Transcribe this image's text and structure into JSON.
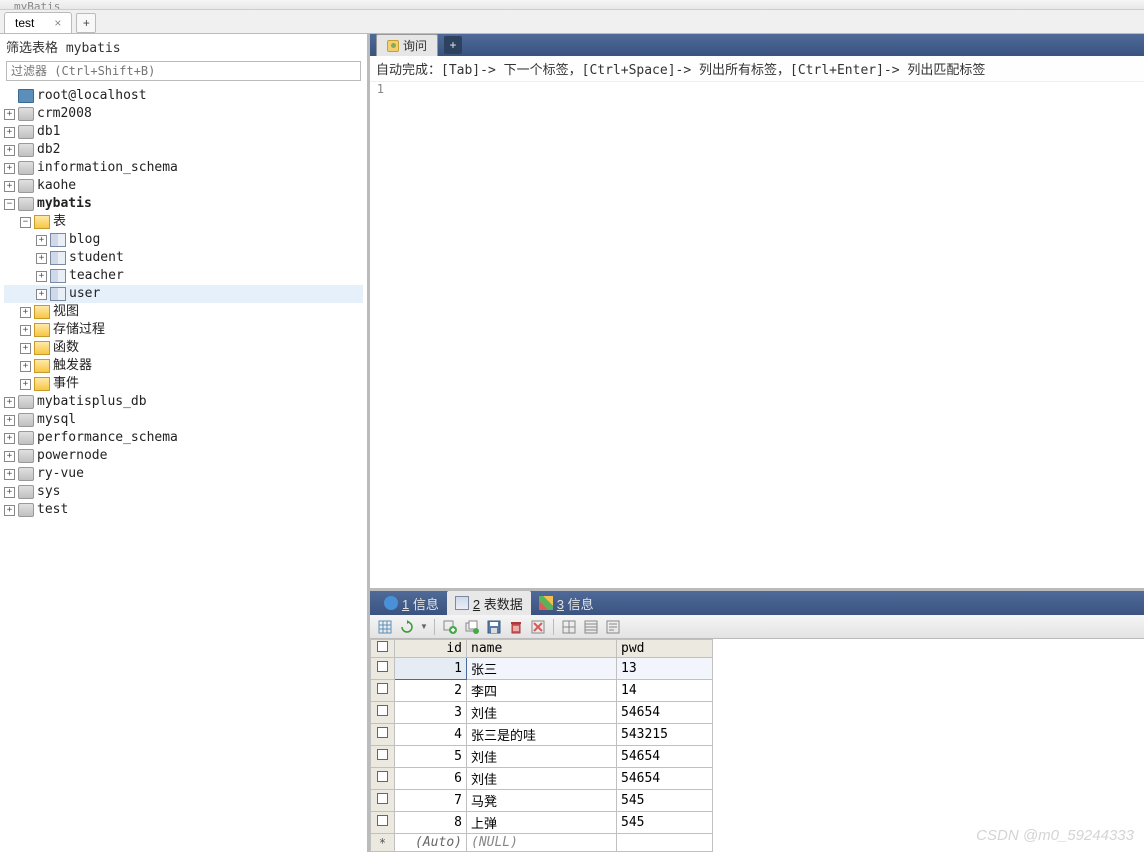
{
  "topbar": {
    "caption": "myBatis"
  },
  "tabs": {
    "items": [
      {
        "label": "test"
      }
    ],
    "add": "+"
  },
  "filter": {
    "label": "筛选表格 mybatis",
    "placeholder": "过滤器 (Ctrl+Shift+B)"
  },
  "tree": {
    "host": "root@localhost",
    "databases": [
      "crm2008",
      "db1",
      "db2",
      "information_schema",
      "kaohe"
    ],
    "open_db": {
      "name": "mybatis",
      "tables_label": "表",
      "tables": [
        "blog",
        "student",
        "teacher",
        "user"
      ],
      "folders": [
        "视图",
        "存储过程",
        "函数",
        "触发器",
        "事件"
      ]
    },
    "rest": [
      "mybatisplus_db",
      "mysql",
      "performance_schema",
      "powernode",
      "ry-vue",
      "sys",
      "test"
    ]
  },
  "query": {
    "tab_label": "询问",
    "hint": "自动完成：[Tab]-> 下一个标签，[Ctrl+Space]-> 列出所有标签，[Ctrl+Enter]-> 列出匹配标签",
    "lines": [
      "1"
    ]
  },
  "result_tabs": {
    "items": [
      {
        "num": "1",
        "label": "信息"
      },
      {
        "num": "2",
        "label": "表数据"
      },
      {
        "num": "3",
        "label": "信息"
      }
    ]
  },
  "grid": {
    "headers": {
      "id": "id",
      "name": "name",
      "pwd": "pwd"
    },
    "rows": [
      {
        "id": "1",
        "name": "张三",
        "pwd": "13"
      },
      {
        "id": "2",
        "name": "李四",
        "pwd": "14"
      },
      {
        "id": "3",
        "name": "刘佳",
        "pwd": "54654"
      },
      {
        "id": "4",
        "name": "张三是的哇",
        "pwd": "543215"
      },
      {
        "id": "5",
        "name": "刘佳",
        "pwd": "54654"
      },
      {
        "id": "6",
        "name": "刘佳",
        "pwd": "54654"
      },
      {
        "id": "7",
        "name": "马凳",
        "pwd": "545"
      },
      {
        "id": "8",
        "name": "上弹",
        "pwd": "545"
      }
    ],
    "footer": {
      "mark": "*",
      "id": "(Auto)",
      "name": "(NULL)",
      "pwd": ""
    }
  },
  "watermark": "CSDN @m0_59244333"
}
